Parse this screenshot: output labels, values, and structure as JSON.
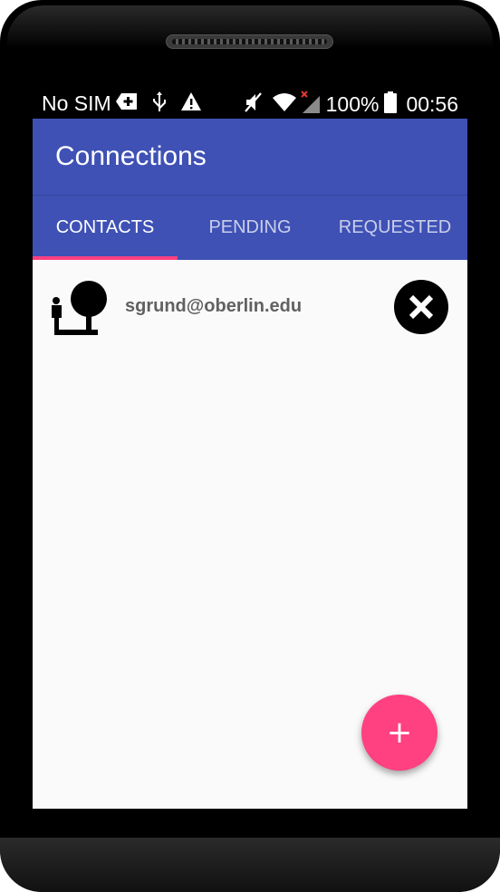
{
  "status_bar": {
    "carrier": "No SIM",
    "battery": "100%",
    "time": "00:56",
    "icons": [
      "sim-plus-icon",
      "usb-icon",
      "warning-icon",
      "mute-icon",
      "wifi-icon",
      "no-signal-icon",
      "battery-icon"
    ]
  },
  "app_bar": {
    "title": "Connections"
  },
  "tabs": [
    {
      "label": "CONTACTS",
      "active": true
    },
    {
      "label": "PENDING",
      "active": false
    },
    {
      "label": "REQUESTED",
      "active": false
    }
  ],
  "contacts": [
    {
      "email": "sgrund@oberlin.edu",
      "avatar_icon": "person-tree-icon",
      "action_icon": "close-icon"
    }
  ],
  "fab": {
    "label": "+",
    "icon": "add-icon"
  },
  "colors": {
    "primary": "#3f51b5",
    "accent": "#ff4081",
    "background": "#fafafa"
  }
}
